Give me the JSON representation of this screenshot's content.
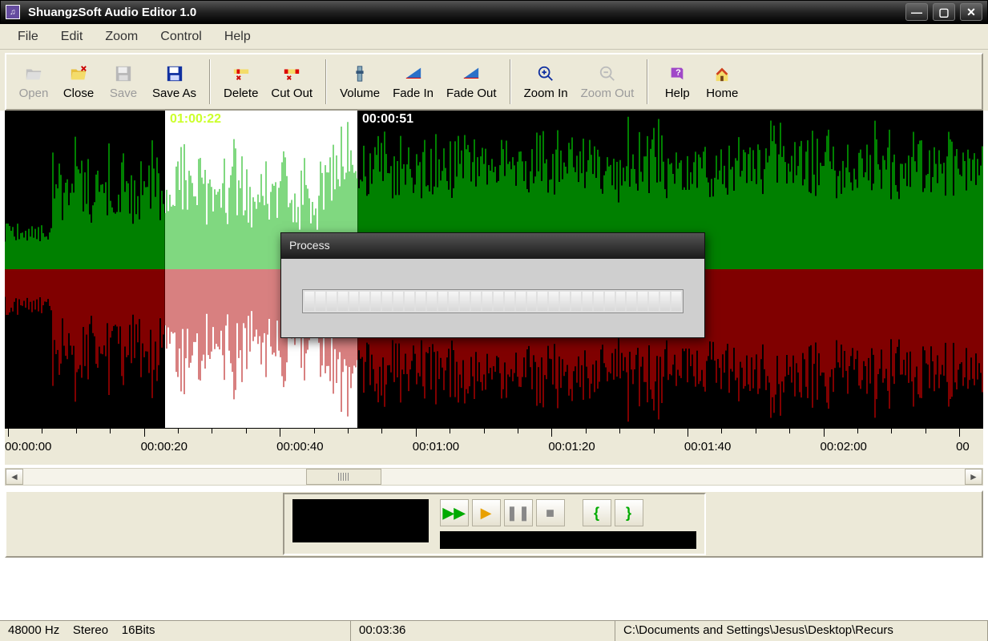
{
  "title": "ShuangzSoft Audio Editor 1.0",
  "menus": {
    "file": "File",
    "edit": "Edit",
    "zoom": "Zoom",
    "control": "Control",
    "help": "Help"
  },
  "toolbar": {
    "open": "Open",
    "close": "Close",
    "save": "Save",
    "saveas": "Save As",
    "delete": "Delete",
    "cutout": "Cut Out",
    "volume": "Volume",
    "fadein": "Fade In",
    "fadeout": "Fade Out",
    "zoomin": "Zoom In",
    "zoomout": "Zoom Out",
    "help": "Help",
    "home": "Home"
  },
  "waveform": {
    "selection_label": "01:00:22",
    "cursor_label": "00:00:51",
    "top_color": "#00ff00",
    "bottom_color": "#ff0000",
    "selected_top_color": "#00b000",
    "selected_bottom_color": "#b00000"
  },
  "ruler": {
    "labels": [
      "00:00:00",
      "00:00:20",
      "00:00:40",
      "00:01:00",
      "00:01:20",
      "00:01:40",
      "00:02:00",
      "00"
    ]
  },
  "dialog": {
    "title": "Process",
    "progress_segments": 34
  },
  "status": {
    "rate": "48000 Hz",
    "channels": "Stereo",
    "bits": "16Bits",
    "time": "00:03:36",
    "path": "C:\\Documents and Settings\\Jesus\\Desktop\\Recurs"
  }
}
